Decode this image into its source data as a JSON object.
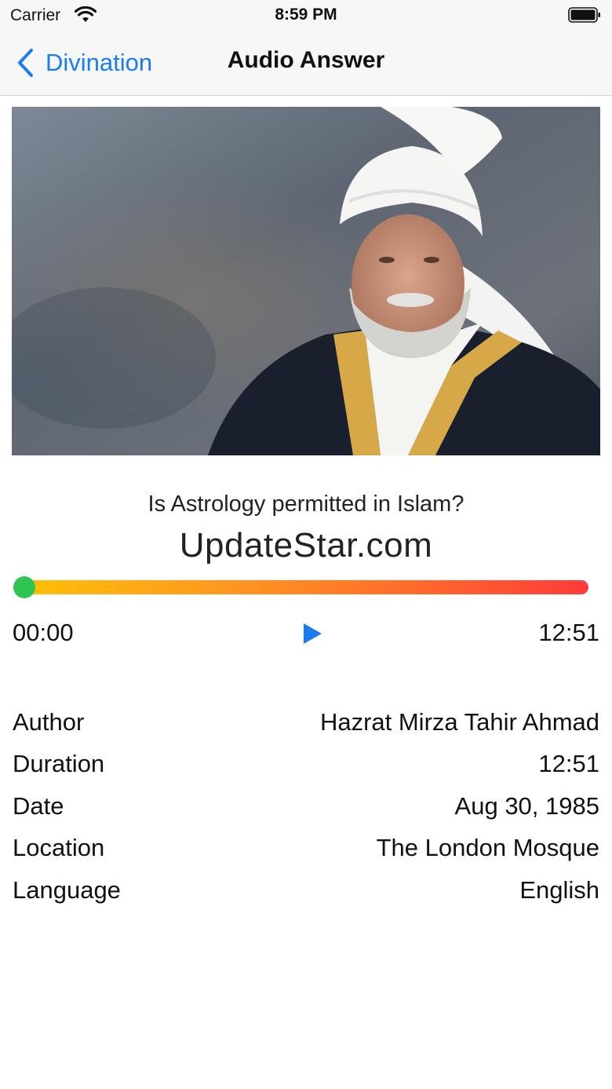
{
  "status_bar": {
    "carrier": "Carrier",
    "time": "8:59 PM"
  },
  "nav": {
    "back_label": "Divination",
    "title": "Audio Answer"
  },
  "colors": {
    "accent": "#1a7cf2",
    "progress_knob": "#2ec553",
    "progress_start": "#ffc107",
    "progress_end": "#ff3b3b"
  },
  "hero": {
    "image_subject": "portrait photo of an elderly bearded man in a white turban and dark robe with gold trim"
  },
  "player": {
    "question": "Is Astrology permitted in Islam?",
    "watermark": "UpdateStar.com",
    "elapsed": "00:00",
    "total": "12:51",
    "progress_fraction": 0.0,
    "play_icon": "play-icon"
  },
  "details": [
    {
      "label": "Author",
      "value": "Hazrat Mirza Tahir Ahmad"
    },
    {
      "label": "Duration",
      "value": "12:51"
    },
    {
      "label": "Date",
      "value": "Aug 30, 1985"
    },
    {
      "label": "Location",
      "value": "The London Mosque"
    },
    {
      "label": "Language",
      "value": "English"
    }
  ]
}
